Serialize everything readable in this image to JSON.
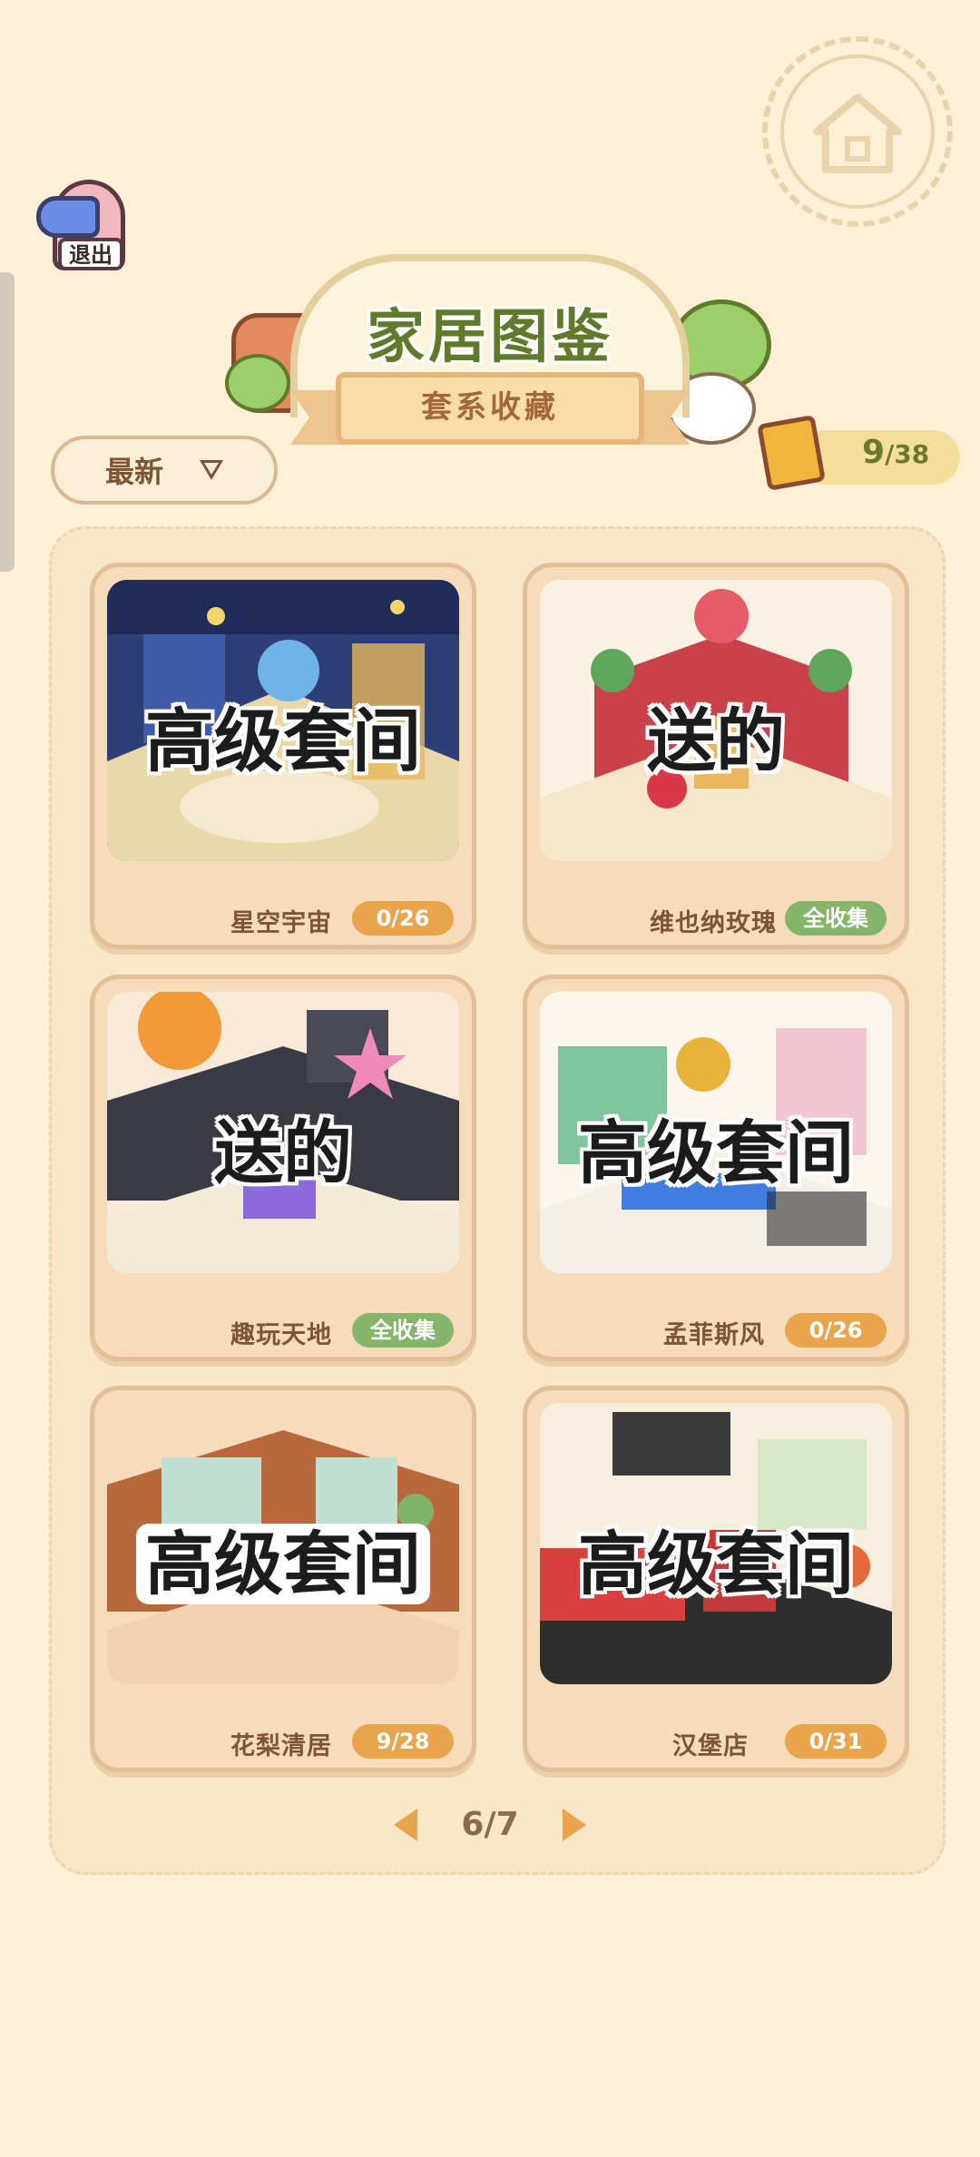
{
  "exit_button": {
    "label": "退出"
  },
  "title": {
    "main": "家居图鉴",
    "subtitle": "套系收藏"
  },
  "sort": {
    "label": "最新"
  },
  "collection_count": {
    "current": "9",
    "total": "/38"
  },
  "cards": [
    {
      "name": "星空宇宙",
      "badge": "0/26",
      "overlay": "高级套间",
      "complete": false
    },
    {
      "name": "维也纳玫瑰",
      "badge": "全收集",
      "overlay": "送的",
      "complete": true
    },
    {
      "name": "趣玩天地",
      "badge": "全收集",
      "overlay": "送的",
      "complete": true
    },
    {
      "name": "孟菲斯风",
      "badge": "0/26",
      "overlay": "高级套间",
      "complete": false
    },
    {
      "name": "花梨清居",
      "badge": "9/28",
      "overlay": "高级套间",
      "complete": false
    },
    {
      "name": "汉堡店",
      "badge": "0/31",
      "overlay": "高级套间",
      "complete": false
    }
  ],
  "pagination": {
    "page": "6/7"
  },
  "colors": {
    "background": "#fdf0d6",
    "badge_progress": "#e9a44c",
    "badge_complete": "#85b56a",
    "title_green": "#5e7a2a"
  }
}
